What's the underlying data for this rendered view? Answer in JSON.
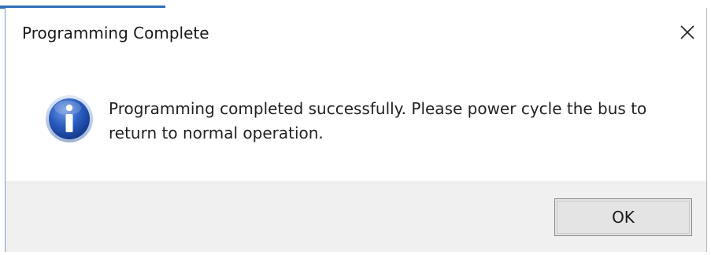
{
  "dialog": {
    "title": "Programming Complete",
    "message": "Programming completed successfully. Please power cycle the bus to return to normal operation.",
    "ok_label": "OK",
    "close_icon": "close-icon",
    "message_icon": "info-icon"
  },
  "colors": {
    "accent": "#2f6fb8",
    "footer_bg": "#f0f0f0",
    "info_icon_blue": "#1f4fa8"
  }
}
